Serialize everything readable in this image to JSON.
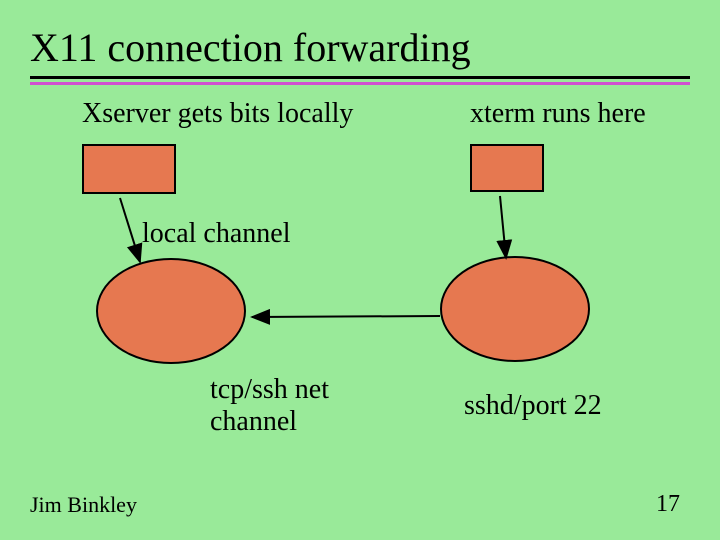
{
  "title": "X11 connection forwarding",
  "labels": {
    "xserver": "Xserver gets bits locally",
    "xterm": "xterm runs here",
    "local_channel": "local channel",
    "tcp_ssh": "tcp/ssh net\nchannel",
    "sshd": "sshd/port 22"
  },
  "footer": {
    "author": "Jim Binkley",
    "page": "17"
  },
  "colors": {
    "background": "#99ea99",
    "shape_fill": "#e67850",
    "accent_line": "#d050d0"
  },
  "diagram": {
    "nodes": [
      {
        "id": "xserver-box",
        "type": "rect",
        "label_ref": "xserver"
      },
      {
        "id": "xterm-box",
        "type": "rect",
        "label_ref": "xterm"
      },
      {
        "id": "ssh-client",
        "type": "ellipse",
        "label_ref": "tcp_ssh"
      },
      {
        "id": "sshd-server",
        "type": "ellipse",
        "label_ref": "sshd"
      }
    ],
    "edges": [
      {
        "from": "xserver-box",
        "to": "ssh-client",
        "label_ref": "local_channel"
      },
      {
        "from": "xterm-box",
        "to": "sshd-server"
      },
      {
        "from": "sshd-server",
        "to": "ssh-client",
        "label_ref": "tcp_ssh"
      }
    ]
  }
}
